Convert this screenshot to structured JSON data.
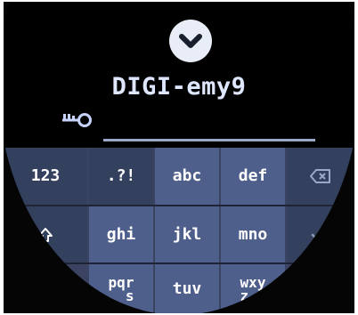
{
  "header": {
    "collapse_icon": "chevron-down-icon",
    "network_name": "DIGI-emy9",
    "field_icon": "key-icon"
  },
  "password_field": {
    "value": ""
  },
  "keyboard": {
    "row1": {
      "numbers": "123",
      "punctuation": ".?!",
      "abc": "abc",
      "def": "def",
      "backspace_icon": "backspace-icon"
    },
    "row2": {
      "shift_icon": "shift-icon",
      "ghi": "ghi",
      "jkl": "jkl",
      "mno": "mno",
      "enter_icon": "check-icon"
    },
    "row3": {
      "pqrs_top": "pqr",
      "pqrs_bottom": "s",
      "tuv": "tuv",
      "wxyz_top": "wxy",
      "wxyz_bottom": "z"
    }
  },
  "colors": {
    "background": "#000000",
    "keyboard_bg": "#3a4361",
    "key_light": "#4f5f8c",
    "text": "#dfe6ff",
    "accent_button": "#e8edf7"
  }
}
